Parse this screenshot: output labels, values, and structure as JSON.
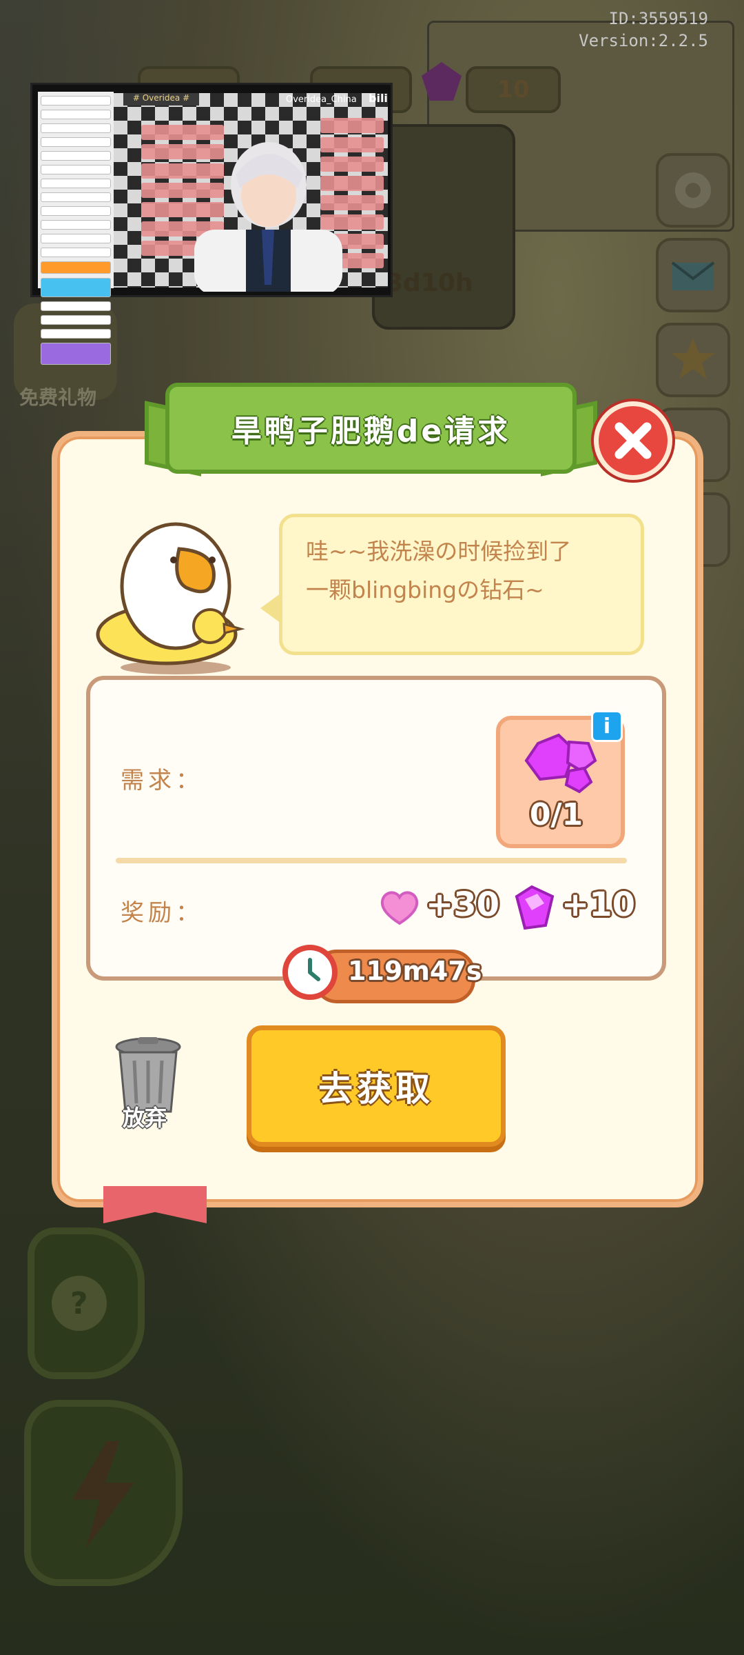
{
  "hud": {
    "id_text": "ID:3559519",
    "version_text": "Version:2.2.5",
    "gem_count": "10",
    "event_timer": "3d10h",
    "free_gift_label": "免费礼物"
  },
  "live_overlay": {
    "channel_tag": "# Overidea #",
    "streamer_name": "Overidea_China",
    "platform_logo": "bili"
  },
  "dialog": {
    "title": "旱鸭子肥鹅de请求",
    "speech_line1": "哇~~我洗澡の时候捡到了",
    "speech_line2": "一颗blingbingの钻石~",
    "requirement_label": "需求：",
    "requirement_progress": "0/1",
    "reward_label": "奖励：",
    "reward_hearts": "+30",
    "reward_gems": "+10",
    "timer": "119m47s",
    "go_button": "去获取",
    "abandon_label": "放弃"
  },
  "colors": {
    "banner_green": "#8bc34a",
    "close_red": "#e8473f",
    "go_yellow": "#ffc928",
    "gem_pink": "#e040fb",
    "heart_pink": "#f48fd6"
  },
  "icons": [
    "close-icon",
    "duck-icon",
    "gem-icon",
    "heart-icon",
    "clock-icon",
    "trash-icon",
    "info-icon",
    "gear-icon",
    "mail-icon",
    "star-icon",
    "help-icon",
    "lightning-icon"
  ]
}
